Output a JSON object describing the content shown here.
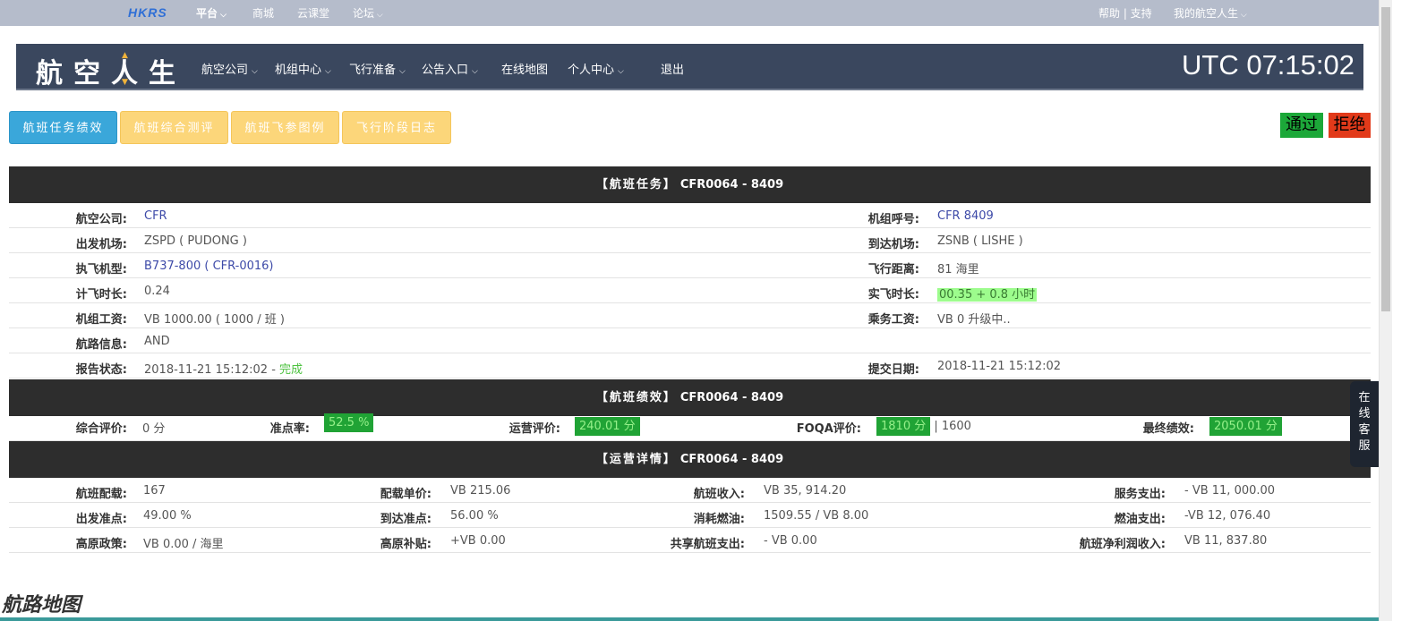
{
  "topbar": {
    "logo": "HKRS",
    "links": [
      "平台",
      "商城",
      "云课堂",
      "论坛"
    ],
    "help": "帮助 | 支持",
    "account": "我的航空人生"
  },
  "header": {
    "brand": "航空人生",
    "nav": [
      "航空公司",
      "机组中心",
      "飞行准备",
      "公告入口",
      "在线地图",
      "个人中心",
      "退出"
    ],
    "clock": "UTC 07:15:02"
  },
  "tabs": [
    "航班任务绩效",
    "航班综合测评",
    "航班飞参图例",
    "飞行阶段日志"
  ],
  "actions": {
    "pass": "通过",
    "reject": "拒绝"
  },
  "task": {
    "title": "【航班任务】",
    "flight": "CFR0064 - 8409",
    "rows": [
      {
        "l1": "航空公司:",
        "v1": "CFR",
        "l2": "机组呼号:",
        "v2": "CFR 8409"
      },
      {
        "l1": "出发机场:",
        "v1": "ZSPD ( PUDONG )",
        "l2": "到达机场:",
        "v2": "ZSNB ( LISHE )"
      },
      {
        "l1": "执飞机型:",
        "v1": "B737-800 ( CFR-0016)",
        "l2": "飞行距离:",
        "v2": "81 海里"
      },
      {
        "l1": "计飞时长:",
        "v1": "0.24",
        "l2": "实飞时长:",
        "v2": "00.35 + 0.8 小时"
      },
      {
        "l1": "机组工资:",
        "v1": "VB 1000.00 ( 1000 / 班 )",
        "l2": "乘务工资:",
        "v2": "VB 0 升级中.."
      },
      {
        "l1": "航路信息:",
        "v1": "AND",
        "l2": "",
        "v2": ""
      },
      {
        "l1": "报告状态:",
        "v1": "2018-11-21 15:12:02 - ",
        "v1b": "完成",
        "l2": "提交日期:",
        "v2": "2018-11-21 15:12:02"
      }
    ]
  },
  "perf": {
    "title": "【航班绩效】",
    "flight": "CFR0064 - 8409",
    "items": [
      {
        "label": "综合评价:",
        "value": "0 分"
      },
      {
        "label": "准点率:",
        "value": "52.5 %"
      },
      {
        "label": "运营评价:",
        "value": "240.01 分"
      },
      {
        "label": "FOQA评价:",
        "value": "1810 分",
        "extra": "| 1600"
      },
      {
        "label": "最终绩效:",
        "value": "2050.01 分"
      }
    ]
  },
  "ops": {
    "title": "【运营详情】",
    "flight": "CFR0064 - 8409",
    "rows": [
      [
        {
          "l": "航班配载:",
          "v": "167"
        },
        {
          "l": "配载单价:",
          "v": "VB 215.06"
        },
        {
          "l": "航班收入:",
          "v": "VB 35, 914.20"
        },
        {
          "l": "服务支出:",
          "v": "- VB 11, 000.00"
        }
      ],
      [
        {
          "l": "出发准点:",
          "v": "49.00 %"
        },
        {
          "l": "到达准点:",
          "v": "56.00 %"
        },
        {
          "l": "消耗燃油:",
          "v": "1509.55 / VB 8.00"
        },
        {
          "l": "燃油支出:",
          "v": "-VB 12, 076.40"
        }
      ],
      [
        {
          "l": "高原政策:",
          "v": "VB 0.00 / 海里"
        },
        {
          "l": "高原补贴:",
          "v": "+VB 0.00"
        },
        {
          "l": "共享航班支出:",
          "v": "- VB 0.00"
        },
        {
          "l": "航班净利润收入:",
          "v": "VB 11, 837.80"
        }
      ]
    ]
  },
  "chat": [
    "在",
    "线",
    "客",
    "服"
  ],
  "map_title": "航路地图"
}
